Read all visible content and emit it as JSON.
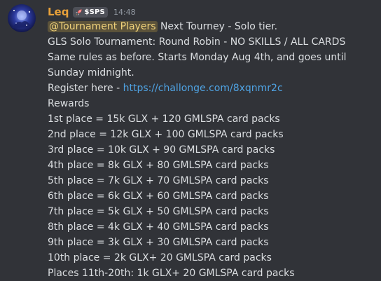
{
  "message": {
    "author": "Leq",
    "role_tag": "$SPS",
    "role_tag_icon": "rocket-icon",
    "timestamp": "14:48",
    "username_color": "#e8a13a",
    "mention": "@Tournament Players",
    "intro_text": "Next Tourney - Solo tier.",
    "line_title": "GLS Solo Tournament: Round Robin - NO SKILLS / ALL CARDS",
    "line_rules": "Same rules as before. Starts Monday Aug 4th, and goes until Sunday midnight.",
    "register_prefix": "Register here - ",
    "register_link": "https://challonge.com/8xqnmr2c",
    "rewards_heading": "Rewards",
    "rewards": [
      "1st place = 15k GLX + 120 GMLSPA card packs",
      "2nd place = 12k GLX + 100 GMLSPA card packs",
      "3rd place = 10k GLX + 90 GMLSPA card packs",
      "4th place = 8k GLX + 80 GMLSPA card packs",
      "5th place = 7k GLX + 70 GMLSPA card packs",
      "6th place = 6k GLX + 60 GMLSPA card packs",
      "7th place = 5k GLX + 50 GMLSPA card packs",
      "8th place = 4k GLX + 40 GMLSPA card packs",
      "9th place = 3k GLX + 30 GMLSPA card packs",
      "10th place = 2k GLX+ 20 GMLSPA card packs",
      "Places 11th-20th: 1k GLX+ 20 GMLSPA card packs"
    ]
  }
}
